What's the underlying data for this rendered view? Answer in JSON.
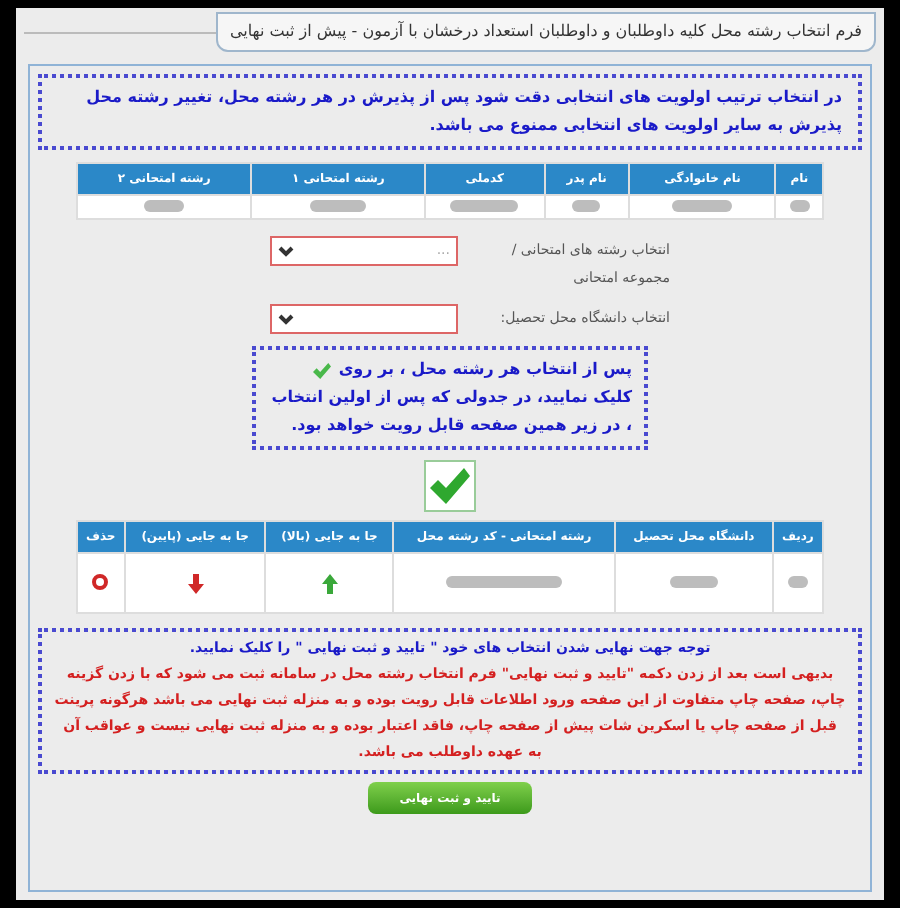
{
  "form_title": "فرم انتخاب رشته محل کلیه داوطلبان و داوطلبان استعداد درخشان با آزمون - پیش از ثبت نهایی",
  "warning": "در انتخاب ترتیب اولویت های انتخابی دقت شود پس از پذیرش در هر رشته محل، تغییر رشته محل پذیرش به سایر اولویت های انتخابی ممنوع می باشد.",
  "applicant_table": {
    "columns": [
      "نام",
      "نام خانوادگی",
      "نام پدر",
      "کدملی",
      "رشته امتحانی ۱",
      "رشته امتحانی ۲"
    ]
  },
  "fields": [
    {
      "label": "انتخاب رشته های امتحانی / مجموعه امتحانی",
      "placeholder": "..."
    },
    {
      "label": "انتخاب دانشگاه محل تحصیل:"
    }
  ],
  "hint": {
    "before": "پس از انتخاب هر رشته محل ، بر روی",
    "after": "کلیک نمایید، در جدولی که پس از اولین انتخاب ، در زیر همین صفحه قابل رویت خواهد بود."
  },
  "choices_table": {
    "columns": [
      "ردیف",
      "دانشگاه محل تحصیل",
      "رشته امتحانی - کد رشته محل",
      "جا به جایی (بالا)",
      "جا به جایی (پایین)",
      "حذف"
    ],
    "rows": [
      {
        "cells": [
          {
            "kind": "redacted"
          },
          {
            "kind": "redacted"
          },
          {
            "kind": "redacted"
          },
          {
            "kind": "up"
          },
          {
            "kind": "down"
          },
          {
            "kind": "delete"
          }
        ]
      }
    ]
  },
  "notice": {
    "title": "توجه جهت نهایی شدن انتخاب های خود \" تایید و ثبت نهایی \" را کلیک نمایید.",
    "body": "بدیهی است بعد از زدن دکمه \"تایید و ثبت نهایی\" فرم انتخاب رشته محل در سامانه ثبت می شود که با زدن گزینه چاپ، صفحه چاپ متفاوت از این صفحه ورود اطلاعات قابل رویت بوده و به منزله ثبت نهایی می باشد هرگونه پرینت قبل از صفحه چاپ یا اسکرین شات پیش از صفحه چاپ، فاقد اعتبار بوده و به منزله ثبت نهایی نیست و عواقب آن به عهده داوطلب می باشد."
  },
  "submit_button": "تایید و ثبت نهایی"
}
